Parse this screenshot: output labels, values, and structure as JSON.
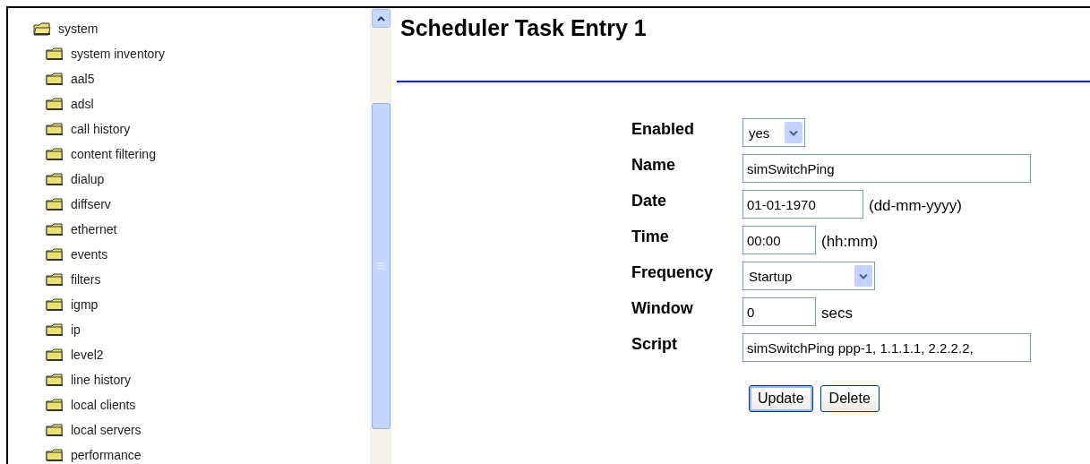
{
  "tree": {
    "label": "system",
    "expanded": true,
    "children": [
      {
        "label": "system inventory"
      },
      {
        "label": "aal5"
      },
      {
        "label": "adsl"
      },
      {
        "label": "call history"
      },
      {
        "label": "content filtering"
      },
      {
        "label": "dialup"
      },
      {
        "label": "diffserv"
      },
      {
        "label": "ethernet"
      },
      {
        "label": "events"
      },
      {
        "label": "filters"
      },
      {
        "label": "igmp"
      },
      {
        "label": "ip"
      },
      {
        "label": "level2"
      },
      {
        "label": "line history"
      },
      {
        "label": "local clients"
      },
      {
        "label": "local servers"
      },
      {
        "label": "performance"
      }
    ]
  },
  "page_title": "Scheduler Task Entry 1",
  "form": [
    {
      "label": "Enabled",
      "kind": "select",
      "value": "yes"
    },
    {
      "label": "Name",
      "kind": "text",
      "value": "simSwitchPing"
    },
    {
      "label": "Date",
      "kind": "text",
      "value": "01-01-1970",
      "hint": "(dd-mm-yyyy)"
    },
    {
      "label": "Time",
      "kind": "text",
      "value": "00:00",
      "hint": "(hh:mm)"
    },
    {
      "label": "Frequency",
      "kind": "select",
      "value": "Startup"
    },
    {
      "label": "Window",
      "kind": "text",
      "value": "0",
      "hint": "secs"
    },
    {
      "label": "Script",
      "kind": "text",
      "value": "simSwitchPing ppp-1, 1.1.1.1, 2.2.2.2,"
    }
  ],
  "buttons": [
    {
      "label": "Update",
      "focused": true
    },
    {
      "label": "Delete",
      "focused": false
    }
  ]
}
